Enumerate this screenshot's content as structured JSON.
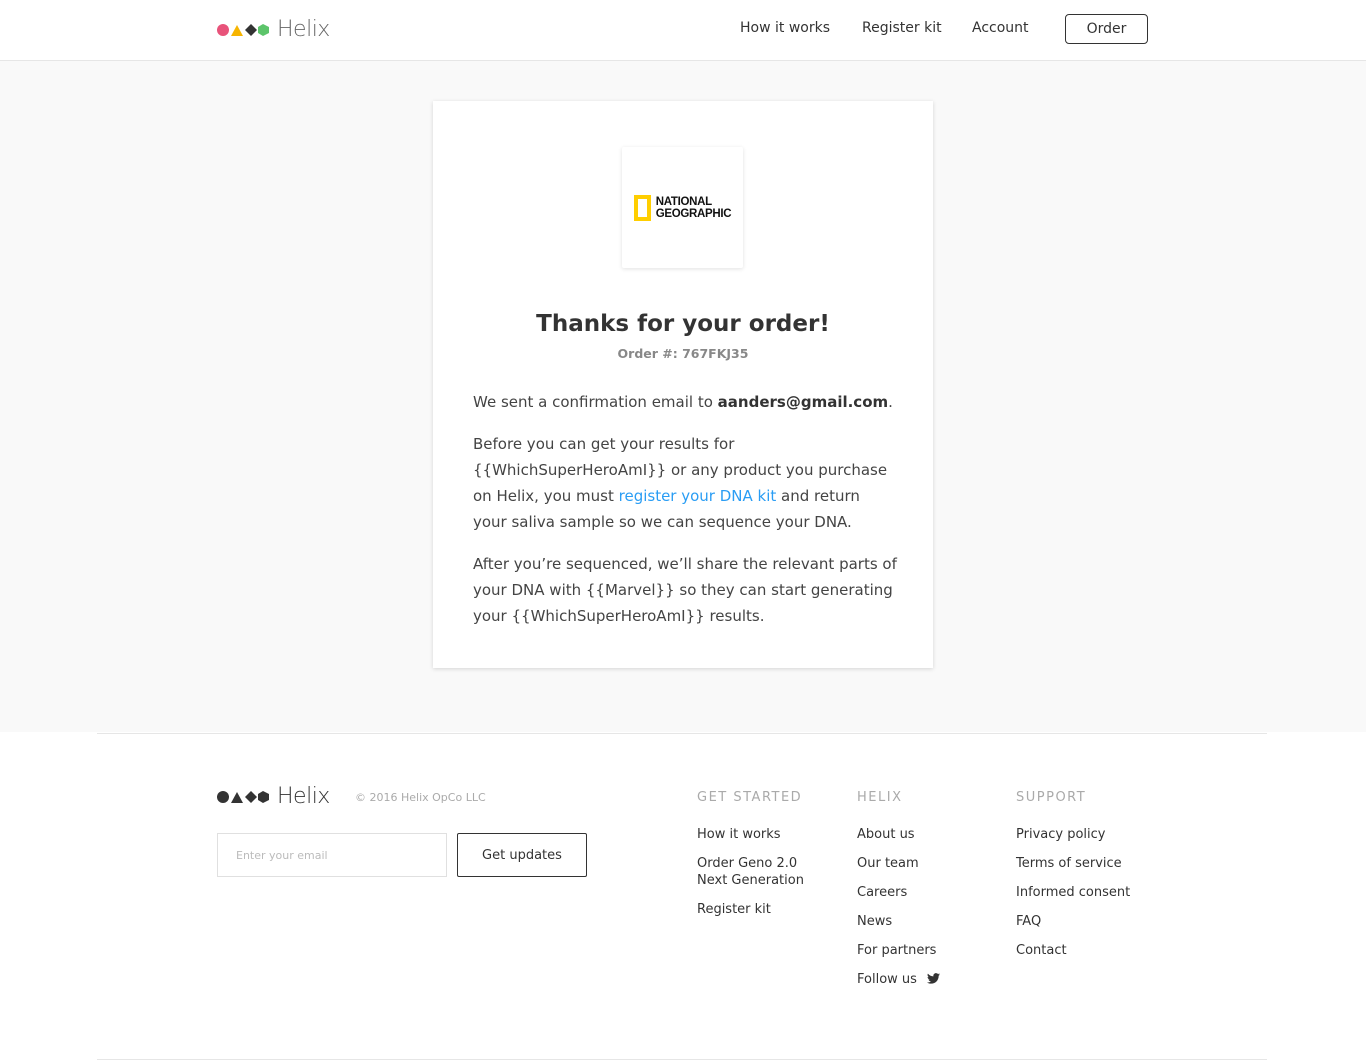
{
  "brand": {
    "name": "Helix",
    "colors": [
      "#e8537a",
      "#f7b500",
      "#333333",
      "#5cc46a"
    ]
  },
  "header": {
    "nav": [
      "How it works",
      "Register kit",
      "Account"
    ],
    "order_label": "Order"
  },
  "card": {
    "partner_logo_text": "NATIONAL\nGEOGRAPHIC",
    "title": "Thanks for your order!",
    "order_number": "Order #: 767FKJ35",
    "email_prefix": "We sent a confirmation email to ",
    "email": "aanders@gmail.com",
    "email_suffix": ".",
    "p2_before": "Before you can get your results for {{WhichSuperHeroAmI}} or any product you purchase on Helix, you must ",
    "p2_link": "register your DNA kit",
    "p2_after": " and return your saliva sample so we can sequence your DNA.",
    "p3": "After you’re sequenced, we’ll share the relevant parts of your DNA with {{Marvel}} so they can start generating your {{WhichSuperHeroAmI}} results."
  },
  "footer": {
    "copyright": "© 2016 Helix OpCo LLC",
    "email_placeholder": "Enter your email",
    "updates_label": "Get updates",
    "columns": [
      {
        "title": "GET STARTED",
        "links": [
          "How it works",
          "Order Geno 2.0 Next Generation",
          "Register kit"
        ]
      },
      {
        "title": "HELIX",
        "links": [
          "About us",
          "Our team",
          "Careers",
          "News",
          "For partners",
          "Follow us"
        ]
      },
      {
        "title": "SUPPORT",
        "links": [
          "Privacy policy",
          "Terms of service",
          "Informed consent",
          "FAQ",
          "Contact"
        ]
      }
    ]
  }
}
